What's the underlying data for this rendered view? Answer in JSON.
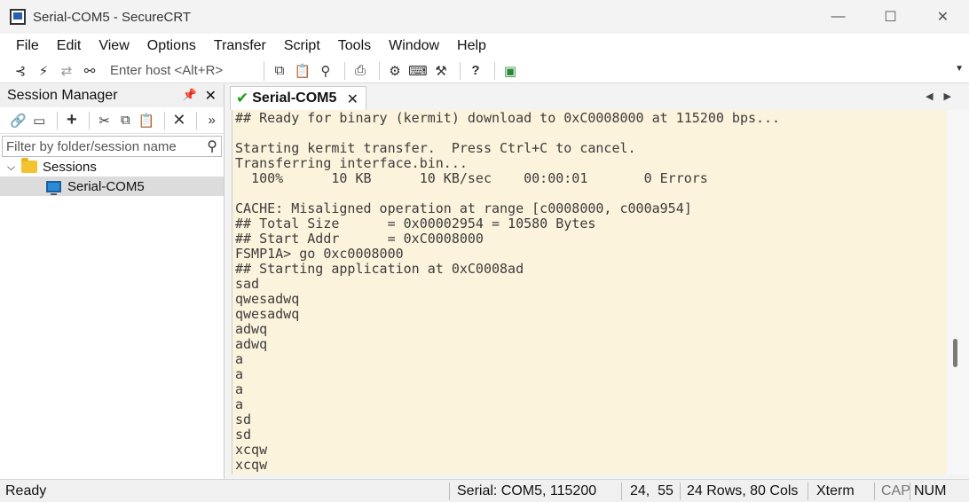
{
  "window": {
    "title": "Serial-COM5 - SecureCRT",
    "minimize": "—",
    "maximize": "☐",
    "close": "✕"
  },
  "menu": [
    "File",
    "Edit",
    "View",
    "Options",
    "Transfer",
    "Script",
    "Tools",
    "Window",
    "Help"
  ],
  "toolbar": {
    "host_placeholder": "Enter host <Alt+R>",
    "icons": [
      "connect-icon",
      "quick-connect-icon",
      "reconnect-icon",
      "disconnect-icon",
      "copy-icon",
      "paste-icon",
      "find-icon",
      "print-icon",
      "settings-icon",
      "keymap-icon",
      "sftp-icon",
      "help-icon",
      "keygen-icon"
    ]
  },
  "session_manager": {
    "title": "Session Manager",
    "filter_placeholder": "Filter by folder/session name",
    "tree": [
      {
        "label": "Sessions",
        "type": "folder",
        "expanded": true
      },
      {
        "label": "Serial-COM5",
        "type": "session",
        "selected": true
      }
    ]
  },
  "tab": {
    "label": "Serial-COM5",
    "status": "connected"
  },
  "terminal": {
    "lines": [
      "## Ready for binary (kermit) download to 0xC0008000 at 115200 bps...",
      "",
      "Starting kermit transfer.  Press Ctrl+C to cancel.",
      "Transferring interface.bin...",
      "  100%      10 KB      10 KB/sec    00:00:01       0 Errors",
      "",
      "CACHE: Misaligned operation at range [c0008000, c000a954]",
      "## Total Size      = 0x00002954 = 10580 Bytes",
      "## Start Addr      = 0xC0008000",
      "FSMP1A> go 0xc0008000",
      "## Starting application at 0xC0008ad",
      "sad",
      "qwesadwq",
      "qwesadwq",
      "adwq",
      "adwq",
      "a",
      "a",
      "a",
      "a",
      "sd",
      "sd",
      "xcqw",
      "xcqw"
    ]
  },
  "status": {
    "ready": "Ready",
    "connection": "Serial: COM5, 115200",
    "cursor": "24,  55",
    "size": "24 Rows, 80 Cols",
    "emulation": "Xterm",
    "cap": "CAP",
    "num": "NUM"
  },
  "colors": {
    "terminal_bg": "#fcf3dc",
    "terminal_fg": "#3c3c3c",
    "connected_check": "#1a9e1a"
  }
}
